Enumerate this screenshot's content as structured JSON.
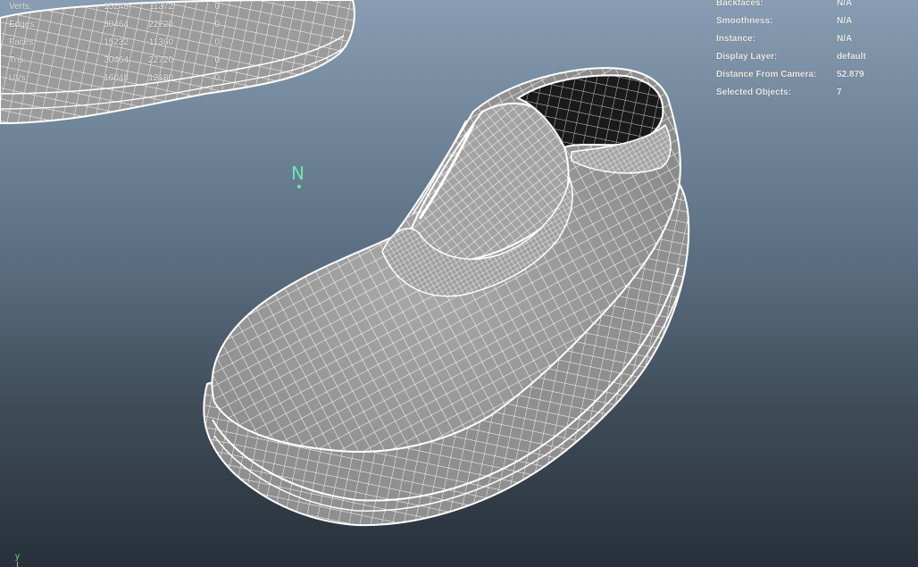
{
  "heads_up_left": {
    "rows": [
      {
        "label": "Verts:",
        "a": "15248",
        "b": "11372",
        "c": "0"
      },
      {
        "label": "Edges:",
        "a": "30464",
        "b": "22720",
        "c": "0"
      },
      {
        "label": "Faces:",
        "a": "15232",
        "b": "11360",
        "c": "0"
      },
      {
        "label": "Tris:",
        "a": "30464",
        "b": "22720",
        "c": "0"
      },
      {
        "label": "UVs:",
        "a": "16048",
        "b": "12180",
        "c": "0"
      }
    ]
  },
  "heads_up_right": {
    "rows": [
      {
        "label": "Backfaces:",
        "value": "N/A"
      },
      {
        "label": "Smoothness:",
        "value": "N/A"
      },
      {
        "label": "Instance:",
        "value": "N/A"
      },
      {
        "label": "Display Layer:",
        "value": "default"
      },
      {
        "label": "Distance From Camera:",
        "value": "52.879"
      },
      {
        "label": "Selected Objects:",
        "value": "7"
      }
    ]
  },
  "manipulator": {
    "label": "N"
  },
  "axis": {
    "y_label": "y"
  },
  "colors": {
    "mesh_fill": "#9a9a9a",
    "wire": "#ffffff",
    "manipulator": "#66e8b0",
    "axis": "#7fd67f"
  }
}
